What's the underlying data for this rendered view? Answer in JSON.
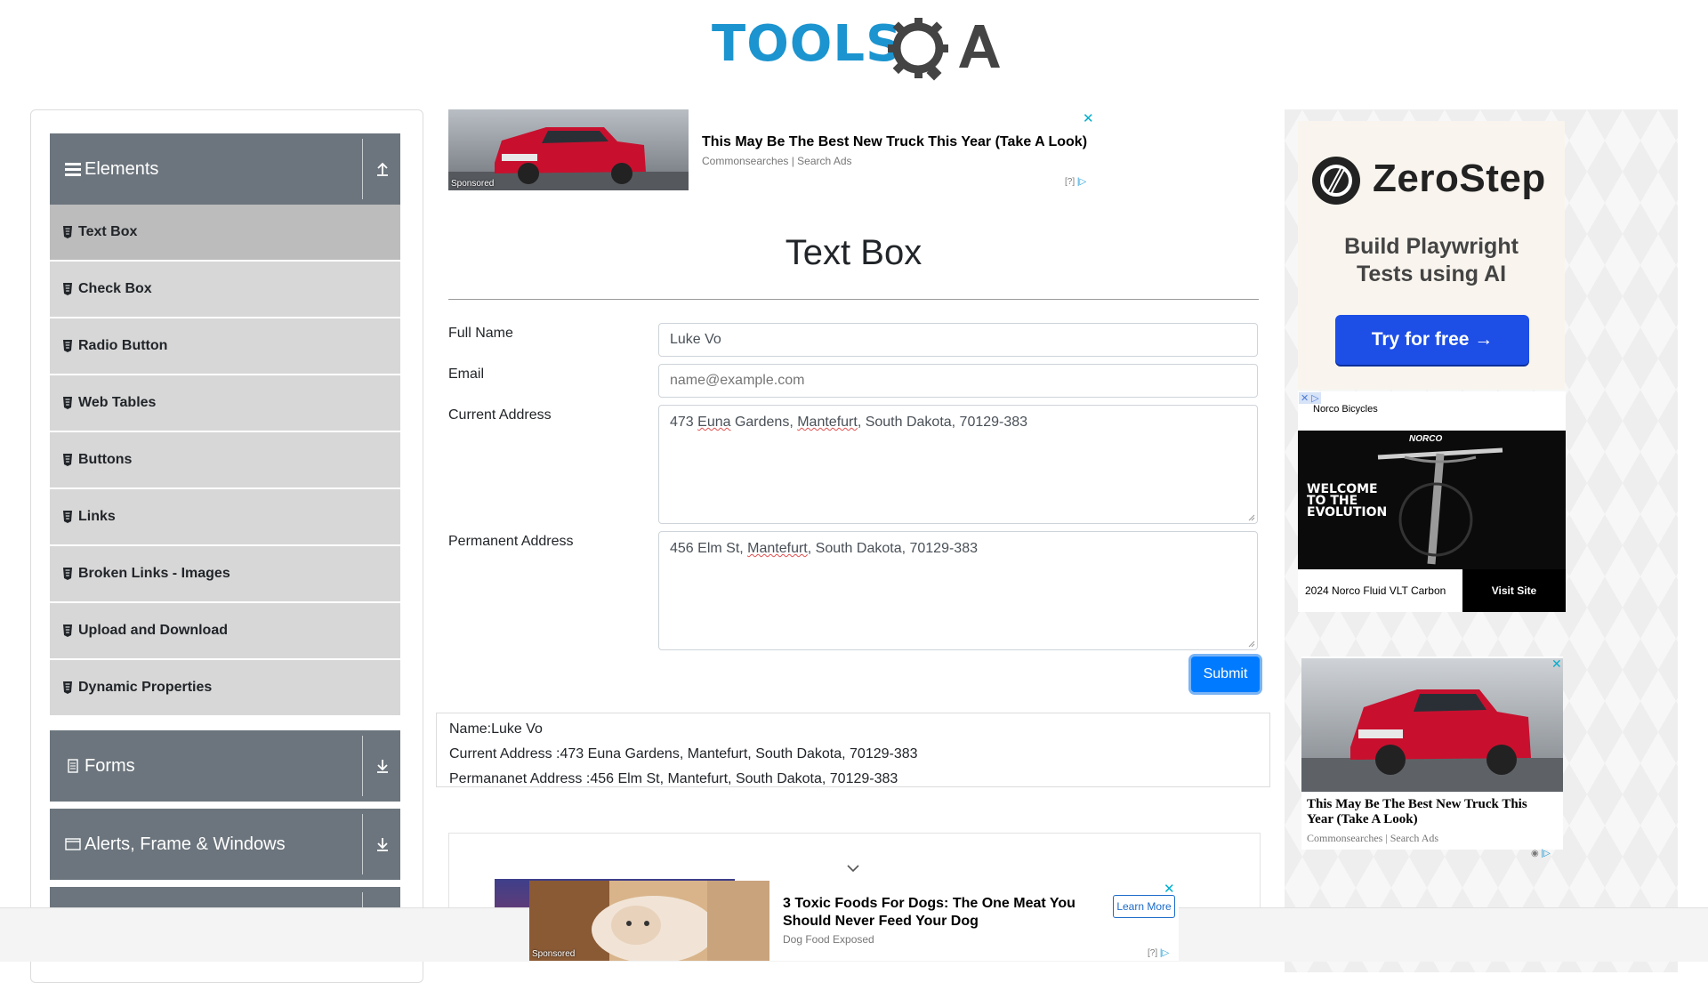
{
  "header": {
    "logo_text": "TOOLSQA",
    "brand_color": "#1b94cf"
  },
  "sidebar": {
    "groups": [
      {
        "label": "Elements",
        "icon": "menu-icon",
        "arrow": "upload-arrow-icon"
      },
      {
        "label": "Forms",
        "icon": "document-icon",
        "arrow": "download-arrow-icon"
      },
      {
        "label": "Alerts, Frame & Windows",
        "icon": "window-icon",
        "arrow": "download-arrow-icon"
      }
    ],
    "items": [
      {
        "label": "Text Box",
        "active": true
      },
      {
        "label": "Check Box"
      },
      {
        "label": "Radio Button"
      },
      {
        "label": "Web Tables"
      },
      {
        "label": "Buttons"
      },
      {
        "label": "Links"
      },
      {
        "label": "Broken Links - Images"
      },
      {
        "label": "Upload and Download"
      },
      {
        "label": "Dynamic Properties"
      }
    ],
    "header_color": "#6c757d",
    "item_color": "#d7d7d7"
  },
  "top_ad": {
    "title": "This May Be The Best New Truck This Year (Take A Look)",
    "source": "Commonsearches | Search Ads",
    "sponsored": "Sponsored",
    "close": "✕",
    "choices": "[?]"
  },
  "main": {
    "title": "Text Box",
    "form": {
      "full_name_label": "Full Name",
      "full_name_value": "Luke Vo",
      "email_label": "Email",
      "email_placeholder": "name@example.com",
      "current_address_label": "Current Address",
      "current_address_parts": [
        "473 ",
        "Euna",
        " Gardens, ",
        "Mantefurt",
        ", South Dakota, 70129-383"
      ],
      "permanent_address_label": "Permanent Address",
      "permanent_address_parts": [
        "456 Elm St, ",
        "Mantefurt",
        ", South Dakota, 70129-383"
      ],
      "submit_label": "Submit",
      "submit_color": "#007bff"
    },
    "output": {
      "name": "Name:Luke Vo",
      "current_address": "Current Address :473 Euna Gardens, Mantefurt, South Dakota, 70129-383",
      "permanent_address": "Permananet Address :456 Elm St, Mantefurt, South Dakota, 70129-383"
    }
  },
  "right_ads": {
    "zerostep": {
      "brand": "ZeroStep",
      "tagline_line1": "Build Playwright",
      "tagline_line2": "Tests using AI",
      "cta": "Try for free →",
      "cta_color": "#1d4ee6"
    },
    "norco": {
      "advertiser": "Norco Bicycles",
      "logo": "NORCO",
      "welcome_line1": "WELCOME",
      "welcome_line2": "TO THE",
      "welcome_line3": "EVOLUTION",
      "model": "2024 Norco Fluid VLT Carbon",
      "cta": "Visit Site"
    },
    "truck": {
      "title": "This May Be The Best New Truck This Year (Take A Look)",
      "source": "Commonsearches | Search Ads",
      "close": "✕"
    }
  },
  "bottom_ad": {
    "title": "3 Toxic Foods For Dogs: The One Meat You Should Never Feed Your Dog",
    "source": "Dog Food Exposed",
    "sponsored": "Sponsored",
    "cta": "Learn More",
    "close": "✕",
    "choices": "[?]"
  }
}
